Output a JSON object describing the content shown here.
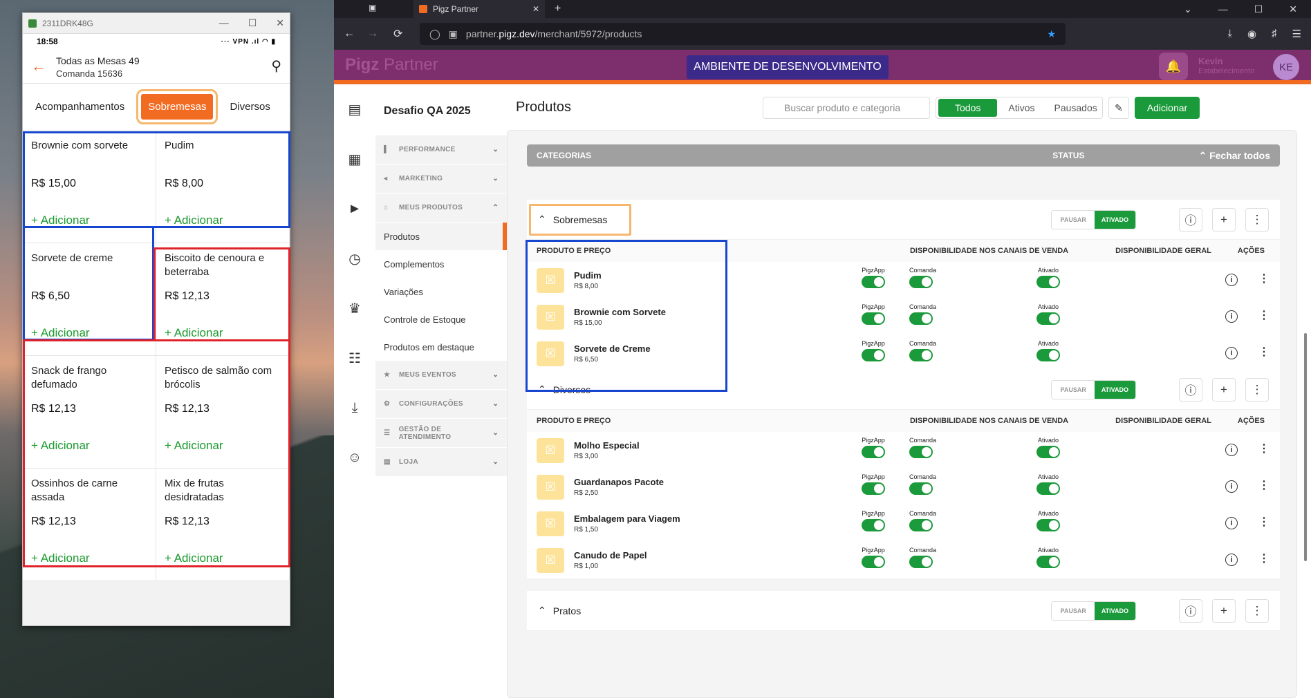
{
  "phone": {
    "window_title": "2311DRK48G",
    "status_time": "18:58",
    "status_icons": "··· VPN .ıl ◠ ▮",
    "header_title": "Todas as Mesas 49",
    "header_subtitle": "Comanda 15636",
    "tabs": [
      "Acompanhamentos",
      "Sobremesas",
      "Diversos"
    ],
    "products": [
      {
        "name": "Brownie com sorvete",
        "price": "R$ 15,00",
        "add": "+ Adicionar"
      },
      {
        "name": "Pudim",
        "price": "R$ 8,00",
        "add": "+ Adicionar"
      },
      {
        "name": "Sorvete de creme",
        "price": "R$ 6,50",
        "add": "+ Adicionar"
      },
      {
        "name": "Biscoito de cenoura e beterraba",
        "price": "R$ 12,13",
        "add": "+ Adicionar"
      },
      {
        "name": "Snack de frango defumado",
        "price": "R$ 12,13",
        "add": "+ Adicionar"
      },
      {
        "name": "Petisco de salmão com brócolis",
        "price": "R$ 12,13",
        "add": "+ Adicionar"
      },
      {
        "name": "Ossinhos de carne assada",
        "price": "R$ 12,13",
        "add": "+ Adicionar"
      },
      {
        "name": "Mix de frutas desidratadas",
        "price": "R$ 12,13",
        "add": "+ Adicionar"
      }
    ]
  },
  "browser": {
    "tab_title": "Pigz Partner",
    "url_host": "partner.",
    "url_domain": "pigz.dev",
    "url_path": "/merchant/5972/products"
  },
  "app": {
    "brand_bold": "Pigz",
    "brand_light": " Partner",
    "dev_banner": "AMBIENTE DE DESENVOLVIMENTO",
    "user_name": "Kevin",
    "user_role": "Estabelecimento",
    "avatar": "KE",
    "store_name": "Desafio QA 2025",
    "menu": [
      {
        "type": "sec",
        "label": "PERFORMANCE",
        "icon": "▌"
      },
      {
        "type": "sec",
        "label": "MARKETING",
        "icon": "◂"
      },
      {
        "type": "sec",
        "label": "MEUS PRODUTOS",
        "icon": "⌂",
        "open": true
      },
      {
        "type": "item",
        "label": "Produtos",
        "active": true
      },
      {
        "type": "item",
        "label": "Complementos"
      },
      {
        "type": "item",
        "label": "Variações"
      },
      {
        "type": "item",
        "label": "Controle de Estoque"
      },
      {
        "type": "item",
        "label": "Produtos em destaque"
      },
      {
        "type": "sec",
        "label": "MEUS EVENTOS",
        "icon": "★"
      },
      {
        "type": "sec",
        "label": "CONFIGURAÇÕES",
        "icon": "⚙"
      },
      {
        "type": "sec",
        "label": "GESTÃO DE ATENDIMENTO",
        "icon": "☰"
      },
      {
        "type": "sec",
        "label": "LOJA",
        "icon": "▤"
      }
    ],
    "page_title": "Produtos",
    "search_placeholder": "Buscar produto e categoria",
    "filters": [
      "Todos",
      "Ativos",
      "Pausados"
    ],
    "add_button": "Adicionar",
    "cat_header": {
      "left": "CATEGORIAS",
      "status": "STATUS",
      "close": "⌃ Fechar todos"
    },
    "table_headers": {
      "product": "PRODUTO E PREÇO",
      "channels": "DISPONIBILIDADE NOS CANAIS DE VENDA",
      "general": "DISPONIBILIDADE GERAL",
      "actions": "AÇÕES"
    },
    "channel_labels": {
      "pigzapp": "PigzApp",
      "comanda": "Comanda",
      "ativado": "Ativado"
    },
    "pause_label": "PAUSAR",
    "active_label": "ATIVADO",
    "categories": [
      {
        "name": "Sobremesas",
        "products": [
          {
            "name": "Pudim",
            "price": "R$ 8,00"
          },
          {
            "name": "Brownie com Sorvete",
            "price": "R$ 15,00"
          },
          {
            "name": "Sorvete de Creme",
            "price": "R$ 6,50"
          }
        ]
      },
      {
        "name": "Diversos",
        "products": [
          {
            "name": "Molho Especial",
            "price": "R$ 3,00"
          },
          {
            "name": "Guardanapos Pacote",
            "price": "R$ 2,50"
          },
          {
            "name": "Embalagem para Viagem",
            "price": "R$ 1,50"
          },
          {
            "name": "Canudo de Papel",
            "price": "R$ 1,00"
          }
        ]
      },
      {
        "name": "Pratos",
        "products": []
      }
    ]
  },
  "colors": {
    "accent": "#f26b22",
    "green": "#1a9a3a",
    "highlight_blue": "#1746d1",
    "highlight_red": "#e0222a",
    "highlight_orange": "#f6b66e"
  }
}
